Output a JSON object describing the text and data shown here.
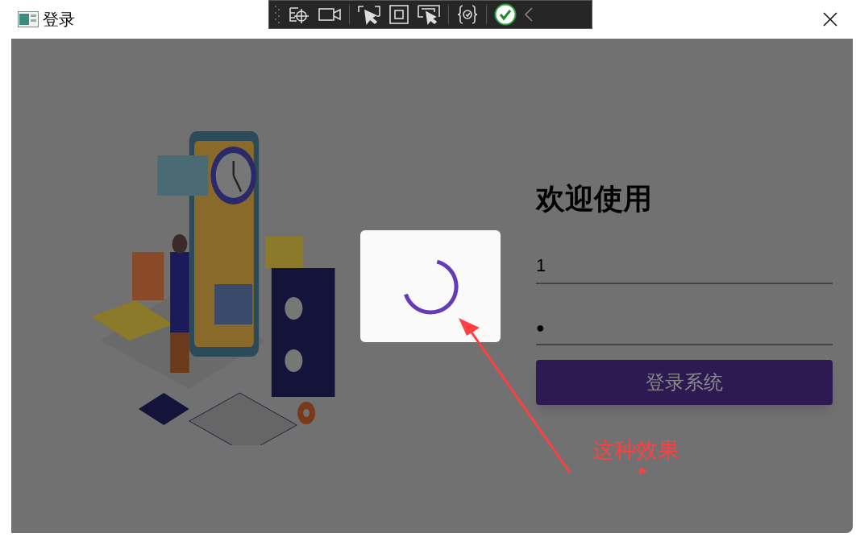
{
  "window": {
    "title": "登录"
  },
  "form": {
    "heading": "欢迎使用",
    "username": {
      "value": "1"
    },
    "password": {
      "value": "●"
    },
    "login_button": "登录系统"
  },
  "loading_dialog": {
    "visible": true
  },
  "annotation": {
    "text": "这种效果"
  }
}
